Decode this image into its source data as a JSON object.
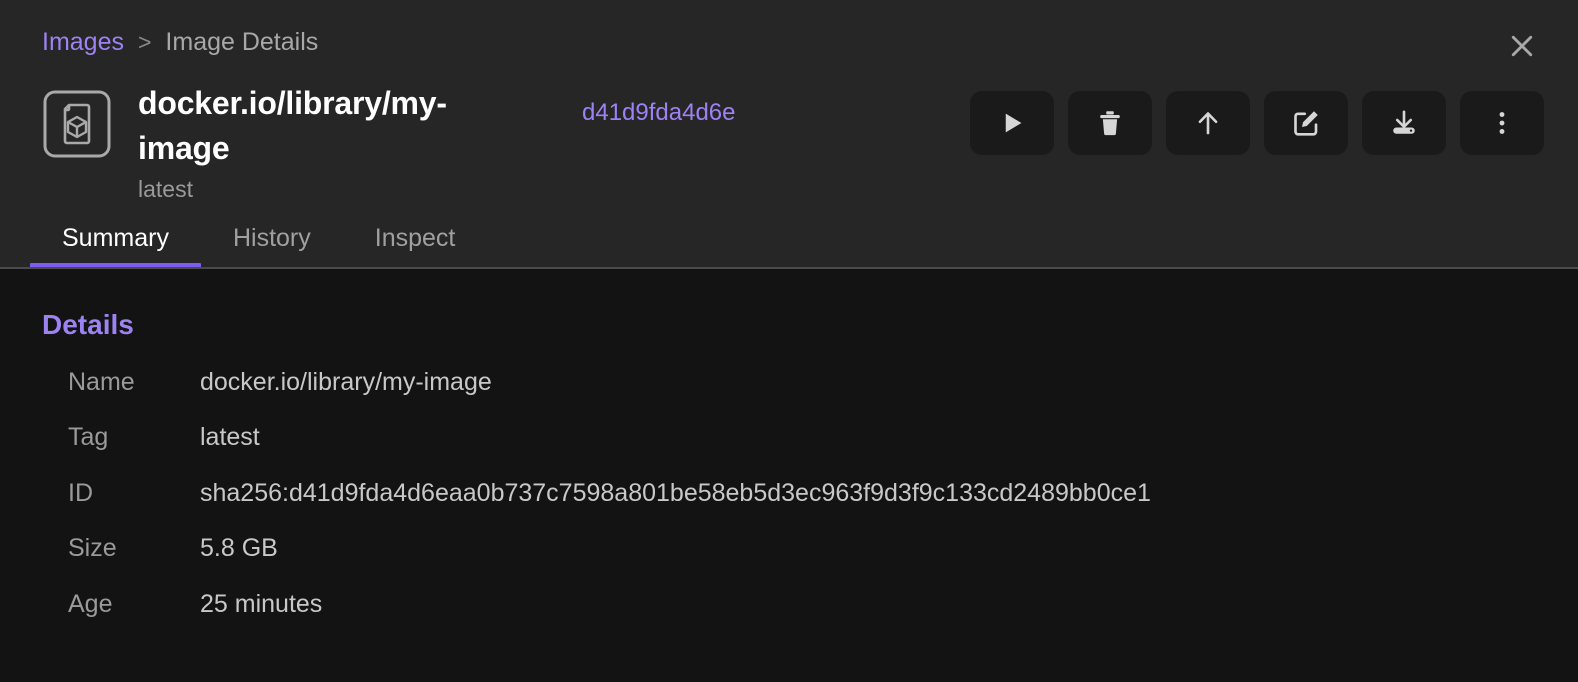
{
  "breadcrumb": {
    "parent": "Images",
    "separator": ">",
    "current": "Image Details"
  },
  "close": {
    "label": "×",
    "icon": "close-icon"
  },
  "image": {
    "icon": "image-file-icon",
    "title": "docker.io/library/my-image",
    "subtitle": "latest",
    "short_hash": "d41d9fda4d6e"
  },
  "actions": [
    {
      "name": "run-button",
      "icon": "play-icon",
      "label": "Run"
    },
    {
      "name": "delete-button",
      "icon": "trash-icon",
      "label": "Delete"
    },
    {
      "name": "push-button",
      "icon": "arrow-up-icon",
      "label": "Push"
    },
    {
      "name": "edit-button",
      "icon": "pencil-square-icon",
      "label": "Edit"
    },
    {
      "name": "save-button",
      "icon": "download-icon",
      "label": "Save"
    },
    {
      "name": "more-button",
      "icon": "kebab-menu-icon",
      "label": "More"
    }
  ],
  "tabs": [
    {
      "label": "Summary",
      "active": true
    },
    {
      "label": "History",
      "active": false
    },
    {
      "label": "Inspect",
      "active": false
    }
  ],
  "details": {
    "heading": "Details",
    "rows": [
      {
        "label": "Name",
        "value": "docker.io/library/my-image"
      },
      {
        "label": "Tag",
        "value": "latest"
      },
      {
        "label": "ID",
        "value": "sha256:d41d9fda4d6eaa0b737c7598a801be58eb5d3ec963f9d3f9c133cd2489bb0ce1"
      },
      {
        "label": "Size",
        "value": "5.8 GB"
      },
      {
        "label": "Age",
        "value": "25 minutes"
      }
    ]
  },
  "colors": {
    "accent": "#9d82f2",
    "accent_underline": "#7d5cf0",
    "header_bg": "#262626",
    "content_bg": "#131313",
    "button_bg": "#1a1a1a",
    "text_primary": "#ffffff",
    "text_secondary": "#9a9a9a",
    "text_value": "#c8c8c8"
  }
}
